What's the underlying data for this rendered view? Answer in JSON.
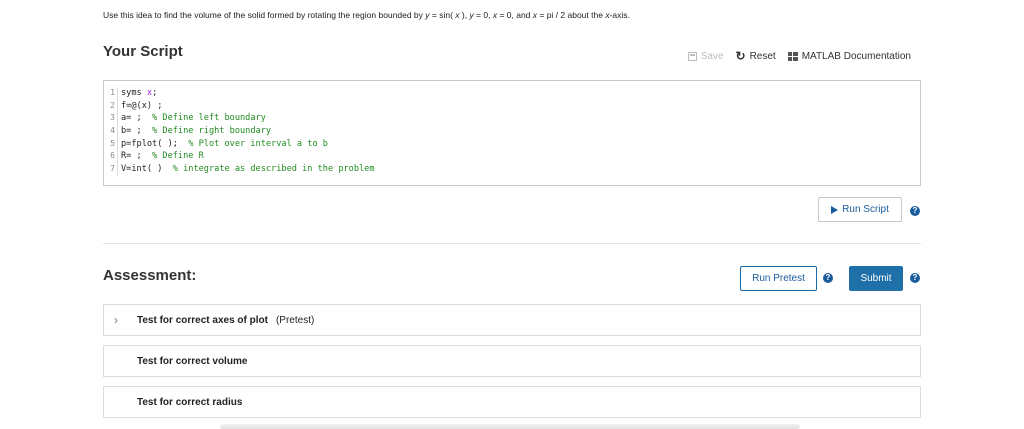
{
  "problem": {
    "prefix": "Use this idea to find the volume of the solid formed by rotating the region bounded by ",
    "y_var": "y",
    "eq1": " = sin( ",
    "x1": "x",
    "eq1_end": " ), ",
    "y_var2": "y",
    "eq2": " = 0, ",
    "x2": "x",
    "eq3": " = 0, and ",
    "x3": "x",
    "eq4": " = pi / 2 about the ",
    "x4": "x",
    "suffix": "-axis."
  },
  "script": {
    "title": "Your Script",
    "save_label": "Save",
    "reset_label": "Reset",
    "doc_label": "MATLAB Documentation",
    "run_label": "Run Script",
    "lines": [
      {
        "num": "1",
        "code": "syms ",
        "kw": "x",
        "code2": ";",
        "comment": ""
      },
      {
        "num": "2",
        "code": "f=@(x) ;",
        "kw": "",
        "code2": "",
        "comment": ""
      },
      {
        "num": "3",
        "code": "a= ;  ",
        "kw": "",
        "code2": "",
        "comment": "% Define left boundary"
      },
      {
        "num": "4",
        "code": "b= ;  ",
        "kw": "",
        "code2": "",
        "comment": "% Define right boundary"
      },
      {
        "num": "5",
        "code": "p=fplot( );  ",
        "kw": "",
        "code2": "",
        "comment": "% Plot over interval a to b"
      },
      {
        "num": "6",
        "code": "R= ;  ",
        "kw": "",
        "code2": "",
        "comment": "% Define R"
      },
      {
        "num": "7",
        "code": "V=int( )  ",
        "kw": "",
        "code2": "",
        "comment": "% integrate as described in the problem"
      }
    ]
  },
  "assessment": {
    "title": "Assessment:",
    "run_pretest_label": "Run Pretest",
    "submit_label": "Submit",
    "tests": [
      {
        "name": "Test for correct axes of plot",
        "tag": "(Pretest)"
      },
      {
        "name": "Test for correct volume",
        "tag": ""
      },
      {
        "name": "Test for correct radius",
        "tag": ""
      }
    ]
  },
  "help_glyph": "?",
  "colors": {
    "accent": "#1a5b9c",
    "submit_bg": "#1f6fa8",
    "comment": "#228b22",
    "keyword": "#a020f0"
  }
}
